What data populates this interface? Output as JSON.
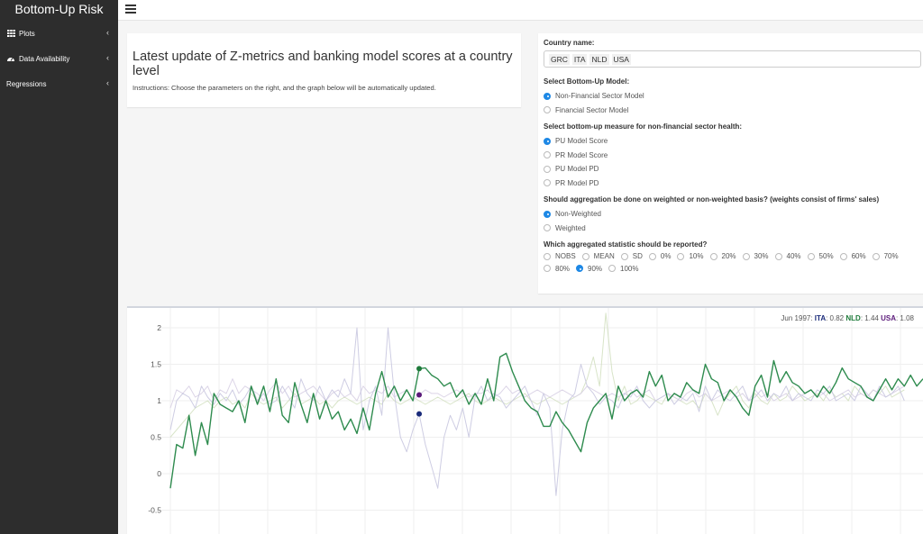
{
  "app": {
    "title": "Bottom-Up Risk"
  },
  "sidebar": {
    "items": [
      {
        "label": "Plots",
        "icon": "table-grid-icon",
        "has_chevron": true
      },
      {
        "label": "Data Availability",
        "icon": "tachometer-icon",
        "has_chevron": true
      },
      {
        "label": "Regressions",
        "icon": "",
        "has_chevron": true
      }
    ]
  },
  "main": {
    "title": "Latest update of Z-metrics and banking model scores at a country level",
    "instructions": "Instructions: Choose the parameters on the right, and the graph below will be automatically updated."
  },
  "controls": {
    "country_label": "Country name:",
    "countries": [
      "GRC",
      "ITA",
      "NLD",
      "USA"
    ],
    "model_label": "Select Bottom-Up Model:",
    "model_options": [
      {
        "label": "Non-Financial Sector Model",
        "selected": true
      },
      {
        "label": "Financial Sector Model",
        "selected": false
      }
    ],
    "measure_label": "Select bottom-up measure for non-financial sector health:",
    "measure_options": [
      {
        "label": "PU Model Score",
        "selected": true
      },
      {
        "label": "PR Model Score",
        "selected": false
      },
      {
        "label": "PU Model PD",
        "selected": false
      },
      {
        "label": "PR Model PD",
        "selected": false
      }
    ],
    "weight_label": "Should aggregation be done on weighted or non-weighted basis? (weights consist of firms' sales)",
    "weight_options": [
      {
        "label": "Non-Weighted",
        "selected": true
      },
      {
        "label": "Weighted",
        "selected": false
      }
    ],
    "stat_label": "Which aggregated statistic should be reported?",
    "stat_options": [
      {
        "label": "NOBS",
        "selected": false
      },
      {
        "label": "MEAN",
        "selected": false
      },
      {
        "label": "SD",
        "selected": false
      },
      {
        "label": "0%",
        "selected": false
      },
      {
        "label": "10%",
        "selected": false
      },
      {
        "label": "20%",
        "selected": false
      },
      {
        "label": "30%",
        "selected": false
      },
      {
        "label": "40%",
        "selected": false
      },
      {
        "label": "50%",
        "selected": false
      },
      {
        "label": "60%",
        "selected": false
      },
      {
        "label": "70%",
        "selected": false
      },
      {
        "label": "80%",
        "selected": false
      },
      {
        "label": "90%",
        "selected": true
      },
      {
        "label": "100%",
        "selected": false
      }
    ]
  },
  "hover": {
    "date": "Jun 1997:",
    "entries": [
      {
        "name": "ITA",
        "value": "0.82",
        "color": "#1a2b7a"
      },
      {
        "name": "NLD",
        "value": "1.44",
        "color": "#1e7a3a"
      },
      {
        "name": "USA",
        "value": "1.08",
        "color": "#5b1a7a"
      }
    ]
  },
  "colors": {
    "nld": "#2e8b4e",
    "ita": "#1a2b7a",
    "usa": "#5b1a7a",
    "grc": "#c8d8b0"
  },
  "chart_data": {
    "type": "line",
    "ylim": [
      -0.5,
      2.4
    ],
    "yticks": [
      2,
      1.5,
      1,
      0.5,
      0,
      -0.5
    ],
    "ytick_labels": [
      "2",
      "1.5",
      "1",
      "0.5",
      "0",
      "-0.5"
    ],
    "highlight_index": 40,
    "series": [
      {
        "name": "NLD",
        "values": [
          -0.2,
          0.4,
          0.35,
          0.8,
          0.25,
          0.7,
          0.4,
          1.1,
          0.95,
          0.9,
          0.85,
          1.0,
          0.7,
          1.2,
          0.95,
          1.2,
          0.85,
          1.3,
          0.8,
          0.7,
          1.25,
          0.95,
          0.7,
          1.1,
          0.75,
          1.0,
          0.75,
          0.85,
          0.6,
          0.75,
          0.55,
          0.9,
          0.6,
          1.1,
          1.4,
          1.05,
          1.2,
          1.0,
          1.15,
          1.0,
          1.44,
          1.45,
          1.35,
          1.3,
          1.2,
          1.25,
          1.05,
          1.15,
          0.95,
          1.1,
          0.95,
          1.3,
          1.0,
          1.6,
          1.65,
          1.4,
          1.2,
          1.0,
          0.9,
          0.85,
          0.65,
          0.65,
          0.85,
          0.7,
          0.6,
          0.45,
          0.3,
          0.7,
          0.9,
          1.0,
          1.1,
          0.75,
          1.2,
          1.0,
          1.1,
          1.15,
          1.05,
          1.4,
          1.2,
          1.35,
          1.0,
          1.1,
          1.05,
          1.25,
          1.15,
          1.1,
          1.5,
          1.3,
          1.25,
          1.0,
          1.15,
          1.05,
          0.9,
          0.8,
          1.2,
          1.35,
          1.05,
          1.55,
          1.25,
          1.4,
          1.25,
          1.2,
          1.1,
          1.15,
          1.05,
          1.2,
          1.1,
          1.25,
          1.45,
          1.3,
          1.25,
          1.2,
          1.05,
          1.0,
          1.15,
          1.3,
          1.15,
          1.3,
          1.2,
          1.35,
          1.2,
          1.3
        ]
      },
      {
        "name": "ITA",
        "values": [
          0.6,
          1.0,
          1.1,
          1.05,
          0.9,
          1.2,
          1.05,
          0.95,
          1.1,
          1.0,
          1.15,
          0.95,
          1.05,
          1.2,
          1.0,
          1.1,
          0.95,
          1.0,
          1.2,
          1.05,
          0.9,
          1.3,
          1.1,
          1.0,
          1.2,
          1.0,
          1.15,
          1.05,
          1.3,
          1.1,
          2.0,
          0.6,
          1.0,
          1.2,
          0.8,
          2.0,
          1.1,
          0.5,
          0.3,
          0.6,
          0.82,
          0.4,
          0.1,
          -0.2,
          0.5,
          0.8,
          0.6,
          0.9,
          0.5,
          1.05,
          1.2,
          1.0,
          1.1,
          1.05,
          0.9,
          1.0,
          1.1,
          1.2,
          1.0,
          0.8,
          1.1,
          0.9,
          -0.3,
          0.6,
          1.0,
          1.1,
          1.5,
          1.2,
          1.1,
          0.95,
          1.05,
          1.0,
          0.9,
          1.1,
          1.05,
          1.2,
          1.0,
          0.9,
          1.0,
          1.05,
          1.1,
          0.95,
          1.05,
          1.0,
          1.1,
          0.85,
          1.2,
          1.0,
          1.15,
          1.05,
          1.0,
          1.1,
          1.2,
          1.0,
          1.05,
          1.15,
          1.0,
          1.1,
          1.05,
          1.2,
          1.0,
          1.1,
          1.05,
          1.0,
          1.15,
          1.1,
          1.2,
          1.0,
          1.05,
          1.1,
          1.0,
          1.2,
          1.1,
          1.0,
          1.2,
          1.05,
          1.1,
          1.2,
          1.0
        ]
      },
      {
        "name": "USA",
        "values": [
          0.9,
          1.15,
          1.1,
          1.2,
          1.05,
          1.1,
          1.2,
          1.0,
          1.15,
          1.1,
          1.3,
          1.1,
          1.2,
          1.15,
          1.1,
          1.0,
          1.15,
          1.25,
          1.1,
          1.2,
          1.05,
          1.1,
          1.15,
          1.2,
          1.1,
          1.0,
          1.1,
          1.15,
          1.05,
          1.1,
          1.0,
          1.2,
          1.1,
          1.15,
          1.1,
          1.2,
          1.05,
          1.1,
          1.15,
          1.0,
          1.08,
          1.15,
          1.1,
          1.1,
          1.05,
          1.1,
          1.15,
          1.1,
          1.05,
          1.1,
          1.1,
          1.15,
          1.05,
          1.1,
          1.2,
          1.1,
          1.15,
          1.05,
          1.1,
          1.15,
          1.1,
          1.05,
          1.1,
          1.15,
          1.1,
          1.05,
          1.1,
          1.2,
          1.15,
          1.1,
          1.05,
          1.1,
          1.05,
          1.1,
          1.15,
          1.05,
          1.1,
          1.15,
          1.0,
          1.05,
          1.1,
          1.05,
          1.0,
          1.1,
          1.15,
          1.05,
          1.1,
          1.0,
          1.05,
          1.1,
          1.15,
          1.05,
          1.1,
          1.0,
          1.15,
          1.05,
          1.1,
          1.0,
          1.05,
          1.1,
          1.0,
          1.05,
          1.1,
          1.15,
          1.05,
          1.1,
          1.0,
          1.05,
          1.1,
          1.15,
          1.05,
          1.1,
          1.05,
          1.15,
          1.1,
          1.05,
          1.1,
          1.15,
          1.2
        ]
      },
      {
        "name": "GRC",
        "values": [
          0.5,
          0.6,
          0.7,
          0.8,
          0.9,
          0.95,
          1.0,
          0.9,
          1.0,
          1.05,
          0.95,
          1.0,
          0.9,
          1.1,
          1.0,
          0.95,
          1.0,
          1.05,
          0.9,
          1.0,
          1.1,
          0.95,
          1.0,
          1.05,
          0.95,
          1.0,
          0.9,
          1.0,
          1.05,
          1.0,
          0.95,
          1.0,
          1.05,
          1.0,
          0.95,
          1.1,
          1.0,
          0.95,
          1.0,
          1.05,
          1.0,
          0.95,
          1.0,
          1.05,
          1.0,
          0.95,
          1.0,
          1.05,
          1.1,
          1.0,
          0.95,
          1.0,
          1.05,
          1.0,
          0.95,
          1.0,
          1.05,
          1.1,
          1.0,
          0.95,
          1.0,
          1.05,
          1.0,
          0.95,
          1.0,
          1.05,
          1.1,
          1.3,
          1.6,
          1.2,
          2.2,
          1.4,
          1.0,
          1.2,
          0.95,
          1.0,
          1.1,
          1.05,
          1.0,
          0.95,
          1.1,
          1.05,
          1.0,
          0.95,
          1.0,
          0.9,
          1.1,
          1.0,
          0.8,
          1.0,
          1.1,
          1.2,
          1.0,
          0.9,
          1.1,
          1.0,
          0.95,
          1.1,
          1.0,
          1.05,
          1.2,
          1.1,
          1.0,
          1.05,
          1.1,
          1.0,
          1.15,
          1.05,
          1.1,
          1.0,
          1.2,
          1.1,
          1.05,
          1.15,
          1.1,
          1.2,
          1.05,
          1.1,
          1.15
        ]
      }
    ]
  }
}
